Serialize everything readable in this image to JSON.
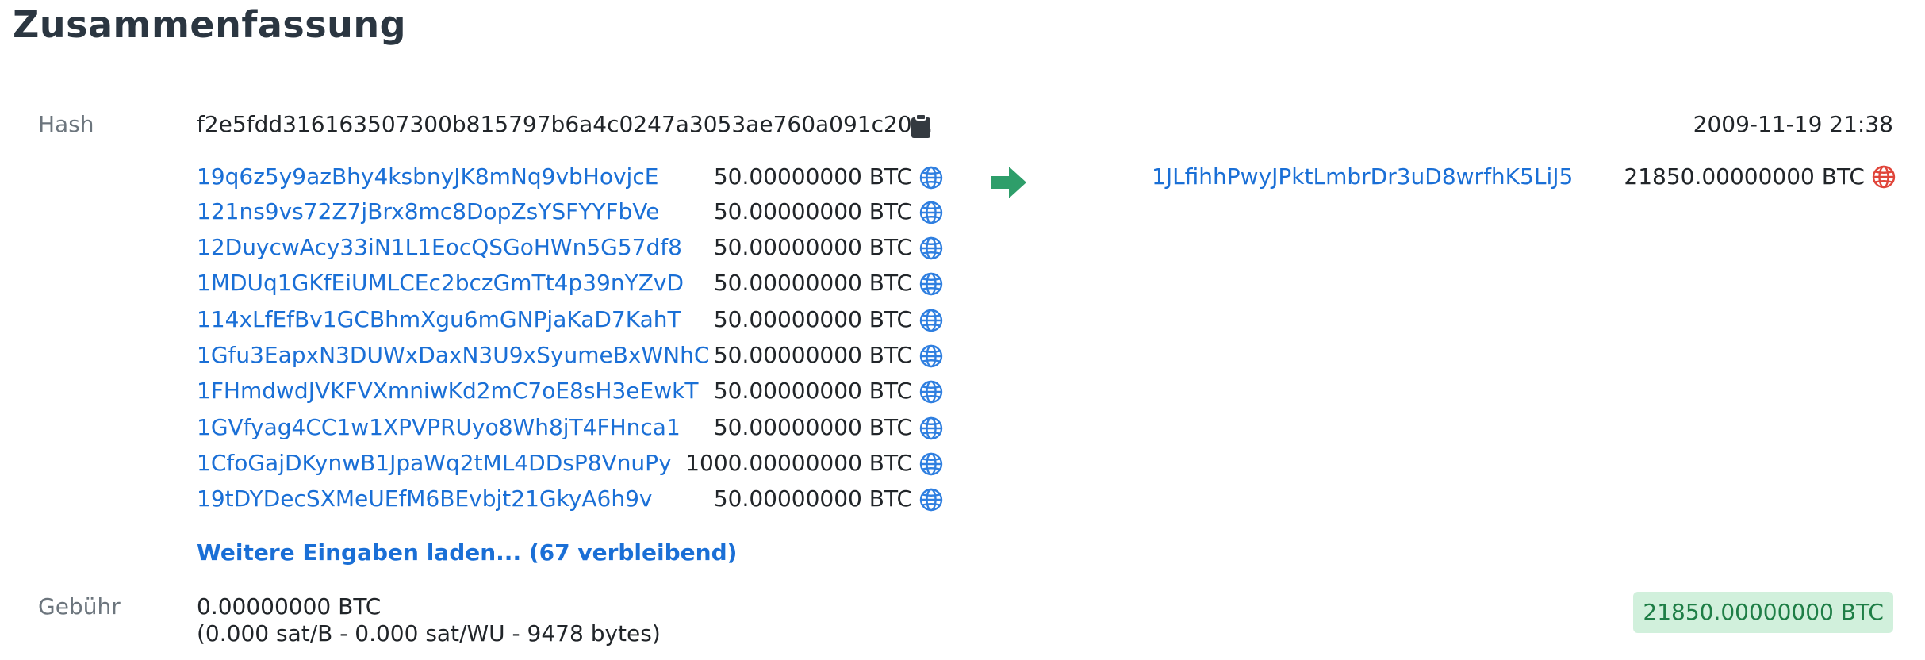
{
  "page_title": "Zusammenfassung",
  "hash_section": {
    "label": "Hash",
    "value": "f2e5fdd316163507300b815797b6a4c0247a3053ae760a091c20...",
    "timestamp": "2009-11-19 21:38"
  },
  "inputs": [
    {
      "address": "19q6z5y9azBhy4ksbnyJK8mNq9vbHovjcE",
      "amount": "50.00000000 BTC"
    },
    {
      "address": "121ns9vs72Z7jBrx8mc8DopZsYSFYYFbVe",
      "amount": "50.00000000 BTC"
    },
    {
      "address": "12DuycwAcy33iN1L1EocQSGoHWn5G57df8",
      "amount": "50.00000000 BTC"
    },
    {
      "address": "1MDUq1GKfEiUMLCEc2bczGmTt4p39nYZvD",
      "amount": "50.00000000 BTC"
    },
    {
      "address": "114xLfEfBv1GCBhmXgu6mGNPjaKaD7KahT",
      "amount": "50.00000000 BTC"
    },
    {
      "address": "1Gfu3EapxN3DUWxDaxN3U9xSyumeBxWNhC",
      "amount": "50.00000000 BTC"
    },
    {
      "address": "1FHmdwdJVKFVXmniwKd2mC7oE8sH3eEwkT",
      "amount": "50.00000000 BTC"
    },
    {
      "address": "1GVfyag4CC1w1XPVPRUyo8Wh8jT4FHnca1",
      "amount": "50.00000000 BTC"
    },
    {
      "address": "1CfoGajDKynwB1JpaWq2tML4DDsP8VnuPy",
      "amount": "1000.00000000 BTC"
    },
    {
      "address": "19tDYDecSXMeUEfM6BEvbjt21GkyA6h9v",
      "amount": "50.00000000 BTC"
    }
  ],
  "load_more": "Weitere Eingaben laden... (67 verbleibend)",
  "output": {
    "address": "1JLfihhPwyJPktLmbrDr3uD8wrfhK5LiJ5",
    "amount": "21850.00000000 BTC"
  },
  "fee": {
    "label": "Gebühr",
    "value": "0.00000000 BTC",
    "detail": "(0.000 sat/B - 0.000 sat/WU - 9478 bytes)"
  },
  "total": "21850.00000000 BTC",
  "icons": {
    "input_globe": "globe-icon",
    "output_globe": "globe-icon",
    "copy": "clipboard-icon",
    "arrow": "arrow-right-icon"
  },
  "colors": {
    "link": "#1a6fd6",
    "input_globe": "#2f7fe0",
    "output_globe": "#e0453a",
    "arrow": "#2e9e6a",
    "badge_bg": "#d1f0dc",
    "badge_text": "#1e7e46"
  }
}
